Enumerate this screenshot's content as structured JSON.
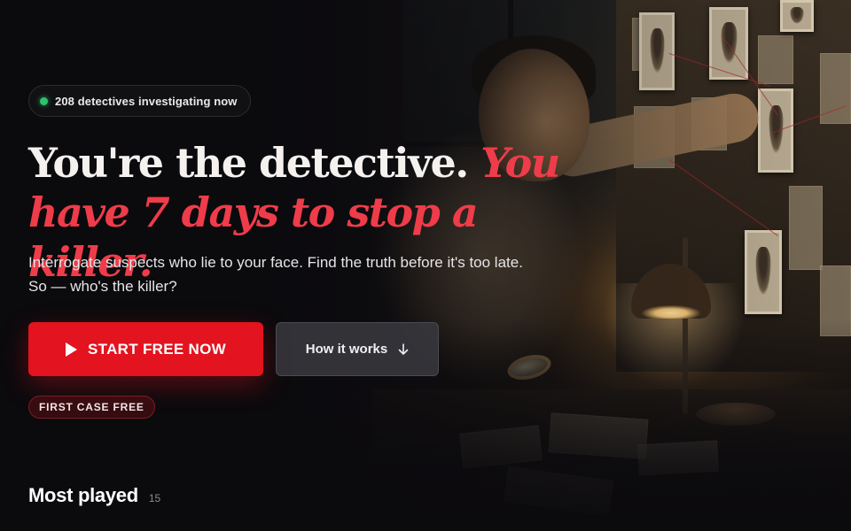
{
  "hero": {
    "live_count_text": "208 detectives investigating now",
    "headline_plain": "You're the detective.",
    "headline_accent": "You have 7 days to stop a killer.",
    "subtitle": "Interrogate suspects who lie to your face. Find the truth before it's too late. So — who's the killer?",
    "primary_cta": "START FREE NOW",
    "secondary_cta": "How it works",
    "badge": "FIRST CASE FREE"
  },
  "section": {
    "title": "Most played",
    "count": "15"
  },
  "colors": {
    "accent": "#e3131f",
    "accent_text": "#ef3c4a",
    "live_dot": "#2ec36b",
    "background": "#0b0a0d"
  },
  "icons": {
    "live": "green-dot-icon",
    "primary_cta": "play-icon",
    "secondary_cta": "arrow-down-icon"
  }
}
